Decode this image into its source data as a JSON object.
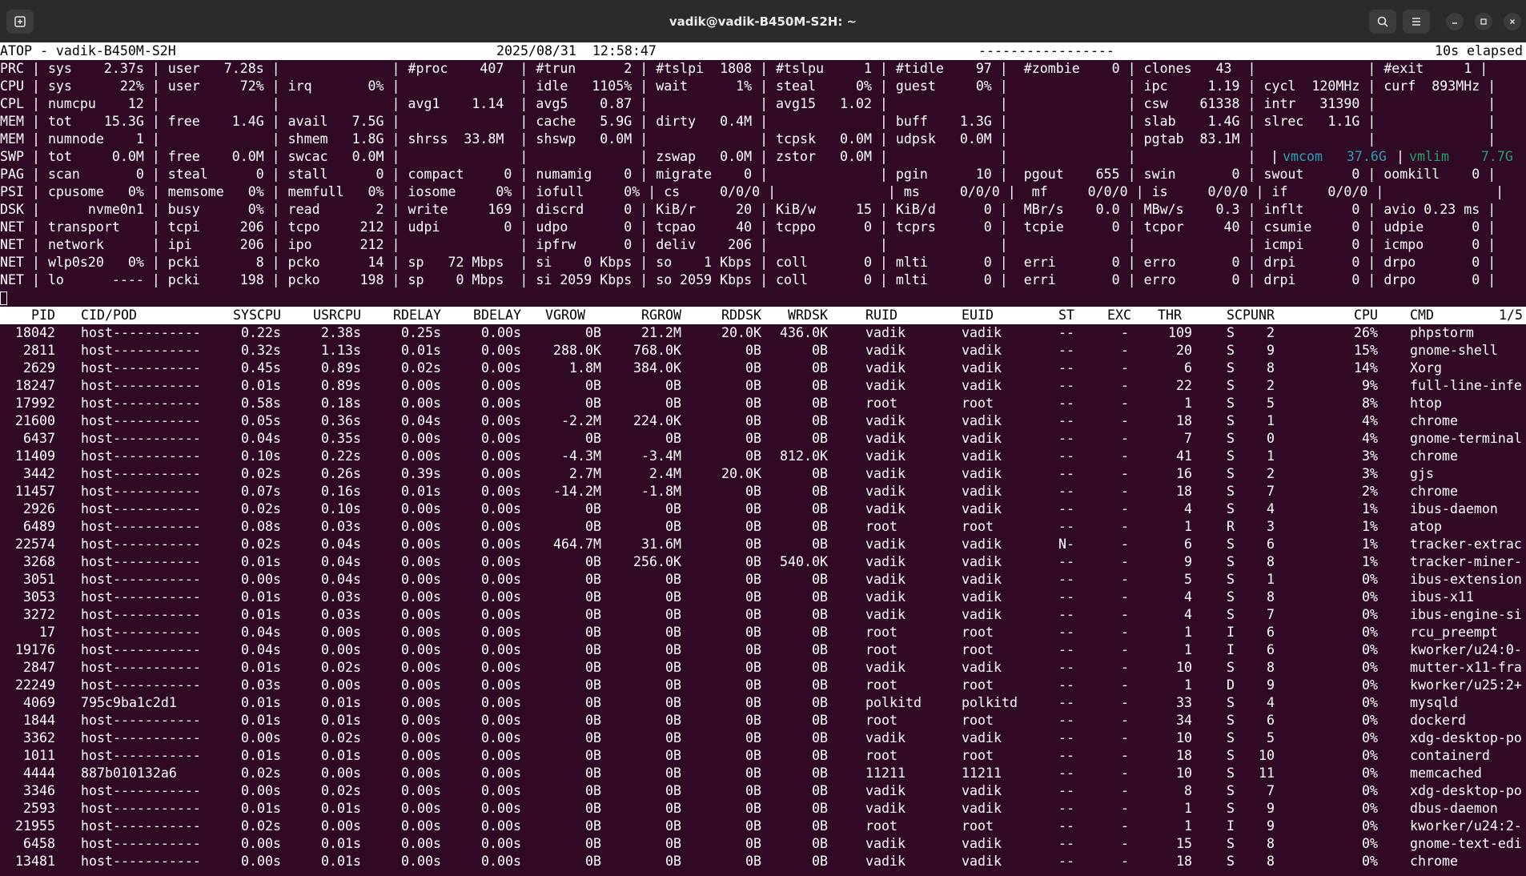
{
  "window": {
    "title": "vadik@vadik-B450M-S2H: ~",
    "icons": {
      "new_tab": "new-tab-icon",
      "search": "search-icon",
      "menu": "hamburger-menu-icon",
      "minimize": "minimize-icon",
      "maximize": "maximize-icon",
      "close": "close-icon"
    }
  },
  "header": {
    "left": "ATOP - vadik-B450M-S2H",
    "date": "2025/08/31  12:58:47",
    "flags": "-----------------",
    "elapsed": "10s elapsed"
  },
  "system_lines": [
    "PRC | sys    2.37s | user   7.28s |              | #proc    407  | #trun      2 | #tslpi  1808 | #tslpu     1 | #tidle    97 |  #zombie    0 | clones   43  |              | #exit     1 |",
    "CPU | sys      22% | user     72% | irq       0% |               | idle   1105% | wait      1% | steal     0% | guest     0% |               | ipc     1.19 | cycl  120MHz | curf  893MHz |",
    "CPL | numcpu    12 |              |              | avg1    1.14  | avg5    0.87 |              | avg15   1.02 |              |               | csw    61338 | intr   31390 |              |",
    "MEM | tot    15.3G | free    1.4G | avail   7.5G |               | cache   5.9G | dirty   0.4M |              | buff    1.3G |               | slab    1.4G | slrec   1.1G |              |",
    "MEM | numnode    1 |              | shmem   1.8G | shrss  33.8M  | shswp   0.0M |              | tcpsk   0.0M | udpsk   0.0M |               | pgtab  83.1M |              |              |",
    "SWP | tot     0.0M | free    0.0M | swcac   0.0M |               |              | zswap   0.0M | zstor   0.0M |              |               |              |",
    "PAG | scan       0 | steal      0 | stall      0 | compact     0 | numamig    0 | migrate    0 |              | pgin      10 |  pgout    655 | swin       0 | swout      0 | oomkill    0 |",
    "PSI | cpusome   0% | memsome   0% | memfull   0% | iosome     0% | iofull     0% | cs     0/0/0 |              | ms     0/0/0 |  mf     0/0/0 | is     0/0/0 | if     0/0/0 |              |",
    "DSK |      nvme0n1 | busy      0% | read       2 | write     169 | discrd     0 | KiB/r     20 | KiB/w     15 | KiB/d      0 |  MBr/s    0.0 | MBw/s    0.3 | inflt      0 | avio 0.23 ms |",
    "NET | transport    | tcpi     206 | tcpo     212 | udpi        0 | udpo       0 | tcpao     40 | tcppo      0 | tcprs      0 |  tcpie      0 | tcpor     40 | csumie     0 | udpie      0 |",
    "NET | network      | ipi      206 | ipo      212 |               | ipfrw      0 | deliv    206 |              |              |               |              | icmpi      0 | icmpo      0 |",
    "NET | wlp0s20   0% | pcki       8 | pcko      14 | sp   72 Mbps  | si    0 Kbps | so    1 Kbps | coll       0 | mlti       0 |  erri       0 | erro       0 | drpi       0 | drpo       0 |",
    "NET | lo      ---- | pcki     198 | pcko     198 | sp    0 Mbps  | si 2059 Kbps | so 2059 Kbps | coll       0 | mlti       0 |  erri       0 | erro       0 | drpi       0 | drpo       0 |"
  ],
  "swp_extra": {
    "vmcom": "vmcom   37.6G",
    "vmlim": "vmlim    7.7G",
    "sep1": "|",
    "sep2": "|"
  },
  "table": {
    "page": "1/5",
    "columns": [
      "PID",
      "CID/POD",
      "SYSCPU",
      "USRCPU",
      "RDELAY",
      "BDELAY",
      "VGROW",
      "RGROW",
      "RDDSK",
      "WRDSK",
      "RUID",
      "EUID",
      "ST",
      "EXC",
      "THR",
      "S",
      "CPUNR",
      "CPU",
      "CMD"
    ],
    "rows": [
      [
        "18042",
        "host-----------",
        "0.22s",
        "2.38s",
        "0.25s",
        "0.00s",
        "0B",
        "21.2M",
        "20.0K",
        "436.0K",
        "vadik",
        "vadik",
        "--",
        "-",
        "109",
        "S",
        "2",
        "26%",
        "phpstorm"
      ],
      [
        "2811",
        "host-----------",
        "0.32s",
        "1.13s",
        "0.01s",
        "0.00s",
        "288.0K",
        "768.0K",
        "0B",
        "0B",
        "vadik",
        "vadik",
        "--",
        "-",
        "20",
        "S",
        "9",
        "15%",
        "gnome-shell"
      ],
      [
        "2629",
        "host-----------",
        "0.45s",
        "0.89s",
        "0.02s",
        "0.00s",
        "1.8M",
        "384.0K",
        "0B",
        "0B",
        "vadik",
        "vadik",
        "--",
        "-",
        "6",
        "S",
        "8",
        "14%",
        "Xorg"
      ],
      [
        "18247",
        "host-----------",
        "0.01s",
        "0.89s",
        "0.00s",
        "0.00s",
        "0B",
        "0B",
        "0B",
        "0B",
        "vadik",
        "vadik",
        "--",
        "-",
        "22",
        "S",
        "2",
        "9%",
        "full-line-infe"
      ],
      [
        "17992",
        "host-----------",
        "0.58s",
        "0.18s",
        "0.00s",
        "0.00s",
        "0B",
        "0B",
        "0B",
        "0B",
        "root",
        "root",
        "--",
        "-",
        "1",
        "S",
        "5",
        "8%",
        "htop"
      ],
      [
        "21600",
        "host-----------",
        "0.05s",
        "0.36s",
        "0.04s",
        "0.00s",
        "-2.2M",
        "224.0K",
        "0B",
        "0B",
        "vadik",
        "vadik",
        "--",
        "-",
        "18",
        "S",
        "1",
        "4%",
        "chrome"
      ],
      [
        "6437",
        "host-----------",
        "0.04s",
        "0.35s",
        "0.00s",
        "0.00s",
        "0B",
        "0B",
        "0B",
        "0B",
        "vadik",
        "vadik",
        "--",
        "-",
        "7",
        "S",
        "0",
        "4%",
        "gnome-terminal"
      ],
      [
        "11409",
        "host-----------",
        "0.10s",
        "0.22s",
        "0.00s",
        "0.00s",
        "-4.3M",
        "-3.4M",
        "0B",
        "812.0K",
        "vadik",
        "vadik",
        "--",
        "-",
        "41",
        "S",
        "1",
        "3%",
        "chrome"
      ],
      [
        "3442",
        "host-----------",
        "0.02s",
        "0.26s",
        "0.39s",
        "0.00s",
        "2.7M",
        "2.4M",
        "20.0K",
        "0B",
        "vadik",
        "vadik",
        "--",
        "-",
        "16",
        "S",
        "2",
        "3%",
        "gjs"
      ],
      [
        "11457",
        "host-----------",
        "0.07s",
        "0.16s",
        "0.01s",
        "0.00s",
        "-14.2M",
        "-1.8M",
        "0B",
        "0B",
        "vadik",
        "vadik",
        "--",
        "-",
        "18",
        "S",
        "7",
        "2%",
        "chrome"
      ],
      [
        "2926",
        "host-----------",
        "0.02s",
        "0.10s",
        "0.00s",
        "0.00s",
        "0B",
        "0B",
        "0B",
        "0B",
        "vadik",
        "vadik",
        "--",
        "-",
        "4",
        "S",
        "4",
        "1%",
        "ibus-daemon"
      ],
      [
        "6489",
        "host-----------",
        "0.08s",
        "0.03s",
        "0.00s",
        "0.00s",
        "0B",
        "0B",
        "0B",
        "0B",
        "root",
        "root",
        "--",
        "-",
        "1",
        "R",
        "3",
        "1%",
        "atop"
      ],
      [
        "22574",
        "host-----------",
        "0.02s",
        "0.04s",
        "0.00s",
        "0.00s",
        "464.7M",
        "31.6M",
        "0B",
        "0B",
        "vadik",
        "vadik",
        "N-",
        "-",
        "6",
        "S",
        "6",
        "1%",
        "tracker-extrac"
      ],
      [
        "3268",
        "host-----------",
        "0.01s",
        "0.04s",
        "0.00s",
        "0.00s",
        "0B",
        "256.0K",
        "0B",
        "540.0K",
        "vadik",
        "vadik",
        "--",
        "-",
        "9",
        "S",
        "8",
        "1%",
        "tracker-miner-"
      ],
      [
        "3051",
        "host-----------",
        "0.00s",
        "0.04s",
        "0.00s",
        "0.00s",
        "0B",
        "0B",
        "0B",
        "0B",
        "vadik",
        "vadik",
        "--",
        "-",
        "5",
        "S",
        "1",
        "0%",
        "ibus-extension"
      ],
      [
        "3053",
        "host-----------",
        "0.01s",
        "0.03s",
        "0.00s",
        "0.00s",
        "0B",
        "0B",
        "0B",
        "0B",
        "vadik",
        "vadik",
        "--",
        "-",
        "4",
        "S",
        "8",
        "0%",
        "ibus-x11"
      ],
      [
        "3272",
        "host-----------",
        "0.01s",
        "0.03s",
        "0.00s",
        "0.00s",
        "0B",
        "0B",
        "0B",
        "0B",
        "vadik",
        "vadik",
        "--",
        "-",
        "4",
        "S",
        "7",
        "0%",
        "ibus-engine-si"
      ],
      [
        "17",
        "host-----------",
        "0.04s",
        "0.00s",
        "0.00s",
        "0.00s",
        "0B",
        "0B",
        "0B",
        "0B",
        "root",
        "root",
        "--",
        "-",
        "1",
        "I",
        "6",
        "0%",
        "rcu_preempt"
      ],
      [
        "19176",
        "host-----------",
        "0.04s",
        "0.00s",
        "0.00s",
        "0.00s",
        "0B",
        "0B",
        "0B",
        "0B",
        "root",
        "root",
        "--",
        "-",
        "1",
        "I",
        "6",
        "0%",
        "kworker/u24:0-"
      ],
      [
        "2847",
        "host-----------",
        "0.01s",
        "0.02s",
        "0.00s",
        "0.00s",
        "0B",
        "0B",
        "0B",
        "0B",
        "vadik",
        "vadik",
        "--",
        "-",
        "10",
        "S",
        "8",
        "0%",
        "mutter-x11-fra"
      ],
      [
        "22249",
        "host-----------",
        "0.03s",
        "0.00s",
        "0.00s",
        "0.00s",
        "0B",
        "0B",
        "0B",
        "0B",
        "root",
        "root",
        "--",
        "-",
        "1",
        "D",
        "9",
        "0%",
        "kworker/u25:2+"
      ],
      [
        "4069",
        "795c9ba1c2d1",
        "0.01s",
        "0.01s",
        "0.00s",
        "0.00s",
        "0B",
        "0B",
        "0B",
        "0B",
        "polkitd",
        "polkitd",
        "--",
        "-",
        "33",
        "S",
        "4",
        "0%",
        "mysqld"
      ],
      [
        "1844",
        "host-----------",
        "0.01s",
        "0.01s",
        "0.00s",
        "0.00s",
        "0B",
        "0B",
        "0B",
        "0B",
        "root",
        "root",
        "--",
        "-",
        "34",
        "S",
        "6",
        "0%",
        "dockerd"
      ],
      [
        "3362",
        "host-----------",
        "0.00s",
        "0.02s",
        "0.00s",
        "0.00s",
        "0B",
        "0B",
        "0B",
        "0B",
        "vadik",
        "vadik",
        "--",
        "-",
        "10",
        "S",
        "5",
        "0%",
        "xdg-desktop-po"
      ],
      [
        "1011",
        "host-----------",
        "0.01s",
        "0.01s",
        "0.00s",
        "0.00s",
        "0B",
        "0B",
        "0B",
        "0B",
        "root",
        "root",
        "--",
        "-",
        "18",
        "S",
        "10",
        "0%",
        "containerd"
      ],
      [
        "4444",
        "887b010132a6",
        "0.02s",
        "0.00s",
        "0.00s",
        "0.00s",
        "0B",
        "0B",
        "0B",
        "0B",
        "11211",
        "11211",
        "--",
        "-",
        "10",
        "S",
        "11",
        "0%",
        "memcached"
      ],
      [
        "3346",
        "host-----------",
        "0.00s",
        "0.02s",
        "0.00s",
        "0.00s",
        "0B",
        "0B",
        "0B",
        "0B",
        "vadik",
        "vadik",
        "--",
        "-",
        "8",
        "S",
        "7",
        "0%",
        "xdg-desktop-po"
      ],
      [
        "2593",
        "host-----------",
        "0.01s",
        "0.01s",
        "0.00s",
        "0.00s",
        "0B",
        "0B",
        "0B",
        "0B",
        "vadik",
        "vadik",
        "--",
        "-",
        "1",
        "S",
        "9",
        "0%",
        "dbus-daemon"
      ],
      [
        "21955",
        "host-----------",
        "0.02s",
        "0.00s",
        "0.00s",
        "0.00s",
        "0B",
        "0B",
        "0B",
        "0B",
        "root",
        "root",
        "--",
        "-",
        "1",
        "I",
        "9",
        "0%",
        "kworker/u24:2-"
      ],
      [
        "6458",
        "host-----------",
        "0.00s",
        "0.01s",
        "0.00s",
        "0.00s",
        "0B",
        "0B",
        "0B",
        "0B",
        "vadik",
        "vadik",
        "--",
        "-",
        "15",
        "S",
        "8",
        "0%",
        "gnome-text-edi"
      ],
      [
        "13481",
        "host-----------",
        "0.00s",
        "0.01s",
        "0.00s",
        "0.00s",
        "0B",
        "0B",
        "0B",
        "0B",
        "vadik",
        "vadik",
        "--",
        "-",
        "18",
        "S",
        "8",
        "0%",
        "chrome"
      ]
    ]
  },
  "colors": {
    "terminal_bg": "#300a24",
    "titlebar_bg": "#2b2b2b",
    "vmcom": "#2aa1b3",
    "vmlim": "#26a269"
  }
}
